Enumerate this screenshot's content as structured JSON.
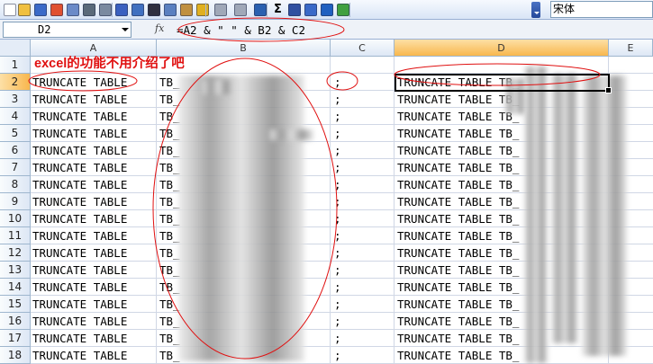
{
  "toolbar": {
    "buttons": [
      {
        "name": "new-icon",
        "label": "",
        "color": "#ffffff"
      },
      {
        "name": "open-folder-icon",
        "label": "",
        "color": "#f0c040"
      },
      {
        "name": "save-icon",
        "label": "",
        "color": "#3a6ac8"
      },
      {
        "name": "permission-icon",
        "label": "",
        "color": "#e05030"
      },
      {
        "name": "email-icon",
        "label": "",
        "color": "#6a8ac8"
      },
      {
        "name": "print-icon",
        "label": "",
        "color": "#5a6a7a"
      },
      {
        "name": "print-preview-icon",
        "label": "",
        "color": "#7a8aa0"
      },
      {
        "name": "spelling-icon",
        "label": "",
        "color": "#3a60c0"
      },
      {
        "name": "research-icon",
        "label": "",
        "color": "#4070c0"
      },
      {
        "name": "cut-icon",
        "label": "",
        "color": "#303040"
      },
      {
        "name": "copy-icon",
        "label": "",
        "color": "#5a80c0"
      },
      {
        "name": "paste-icon",
        "label": "",
        "color": "#c09040"
      },
      {
        "name": "format-painter-icon",
        "label": "",
        "color": "#e0b020"
      },
      {
        "name": "undo-icon",
        "label": "",
        "color": "#a0a8b8"
      },
      {
        "name": "redo-icon",
        "label": "",
        "color": "#a0a8b8"
      },
      {
        "name": "hyperlink-icon",
        "label": "",
        "color": "#2a60b0"
      },
      {
        "name": "autosum-icon",
        "label": "Σ",
        "color": "#000000"
      },
      {
        "name": "sort-icon",
        "label": "",
        "color": "#3050a0"
      },
      {
        "name": "chart-wizard-icon",
        "label": "",
        "color": "#3a6ac8"
      },
      {
        "name": "help-icon",
        "label": "",
        "color": "#2060c0"
      },
      {
        "name": "drawing-icon",
        "label": "",
        "color": "#40a040"
      }
    ],
    "font_name": "宋体"
  },
  "formula_bar": {
    "name_box": "D2",
    "fx": "fx",
    "formula": "=A2 & \" \" & B2 & C2"
  },
  "grid": {
    "columns": [
      "A",
      "B",
      "C",
      "D",
      "E"
    ],
    "selected_column": "D",
    "selected_row": "2",
    "rows": [
      {
        "num": "1",
        "a": "",
        "b": "",
        "c": "",
        "d": ""
      },
      {
        "num": "2",
        "a": "TRUNCATE TABLE",
        "b": "TB_",
        "c": ";",
        "d": "TRUNCATE TABLE TB_"
      },
      {
        "num": "3",
        "a": "TRUNCATE TABLE",
        "b": "TB_",
        "c": ";",
        "d": "TRUNCATE TABLE TB_"
      },
      {
        "num": "4",
        "a": "TRUNCATE TABLE",
        "b": "TB_",
        "c": ";",
        "d": "TRUNCATE TABLE TB_"
      },
      {
        "num": "5",
        "a": "TRUNCATE TABLE",
        "b": "TB_",
        "c": ";",
        "d": "TRUNCATE TABLE TB_"
      },
      {
        "num": "6",
        "a": "TRUNCATE TABLE",
        "b": "TB_",
        "c": ";",
        "d": "TRUNCATE TABLE TB_"
      },
      {
        "num": "7",
        "a": "TRUNCATE TABLE",
        "b": "TB_",
        "c": ";",
        "d": "TRUNCATE TABLE TB_"
      },
      {
        "num": "8",
        "a": "TRUNCATE TABLE",
        "b": "TB_",
        "c": ";",
        "d": "TRUNCATE TABLE TB_"
      },
      {
        "num": "9",
        "a": "TRUNCATE TABLE",
        "b": "TB_",
        "c": ";",
        "d": "TRUNCATE TABLE TB_"
      },
      {
        "num": "10",
        "a": "TRUNCATE TABLE",
        "b": "TB_",
        "c": ";",
        "d": "TRUNCATE TABLE TB_"
      },
      {
        "num": "11",
        "a": "TRUNCATE TABLE",
        "b": "TB_",
        "c": ";",
        "d": "TRUNCATE TABLE TB_"
      },
      {
        "num": "12",
        "a": "TRUNCATE TABLE",
        "b": "TB_",
        "c": ";",
        "d": "TRUNCATE TABLE TB_"
      },
      {
        "num": "13",
        "a": "TRUNCATE TABLE",
        "b": "TB_",
        "c": ";",
        "d": "TRUNCATE TABLE TB_"
      },
      {
        "num": "14",
        "a": "TRUNCATE TABLE",
        "b": "TB_",
        "c": ";",
        "d": "TRUNCATE TABLE TB_"
      },
      {
        "num": "15",
        "a": "TRUNCATE TABLE",
        "b": "TB_",
        "c": ";",
        "d": "TRUNCATE TABLE TB_"
      },
      {
        "num": "16",
        "a": "TRUNCATE TABLE",
        "b": "TB_",
        "c": ";",
        "d": "TRUNCATE TABLE TB_"
      },
      {
        "num": "17",
        "a": "TRUNCATE TABLE",
        "b": "TB_",
        "c": ";",
        "d": "TRUNCATE TABLE TB_"
      },
      {
        "num": "18",
        "a": "TRUNCATE TABLE",
        "b": "TB_",
        "c": ";",
        "d": "TRUNCATE TABLE TB_"
      }
    ]
  },
  "annotation": {
    "text": "excel的功能不用介绍了吧",
    "color": "#e01010"
  }
}
